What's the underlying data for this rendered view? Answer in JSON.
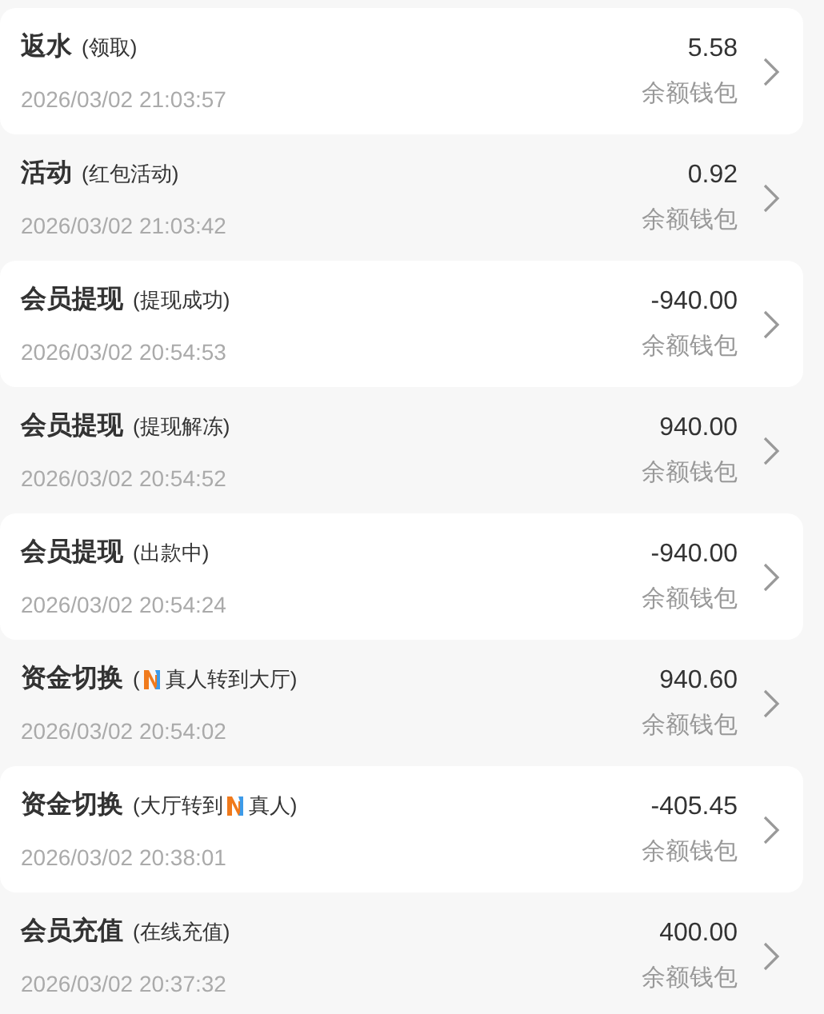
{
  "records": [
    {
      "title": "返水",
      "detail": [
        {
          "kind": "text",
          "text": "(领取)"
        }
      ],
      "time": "2026/03/02 21:03:57",
      "amount": "5.58",
      "wallet": "余额钱包"
    },
    {
      "title": "活动",
      "detail": [
        {
          "kind": "text",
          "text": "(红包活动)"
        }
      ],
      "time": "2026/03/02 21:03:42",
      "amount": "0.92",
      "wallet": "余额钱包"
    },
    {
      "title": "会员提现",
      "detail": [
        {
          "kind": "text",
          "text": "(提现成功)"
        }
      ],
      "time": "2026/03/02 20:54:53",
      "amount": "-940.00",
      "wallet": "余额钱包"
    },
    {
      "title": "会员提现",
      "detail": [
        {
          "kind": "text",
          "text": "(提现解冻)"
        }
      ],
      "time": "2026/03/02 20:54:52",
      "amount": "940.00",
      "wallet": "余额钱包"
    },
    {
      "title": "会员提现",
      "detail": [
        {
          "kind": "text",
          "text": "(出款中)"
        }
      ],
      "time": "2026/03/02 20:54:24",
      "amount": "-940.00",
      "wallet": "余额钱包"
    },
    {
      "title": "资金切换",
      "detail": [
        {
          "kind": "text",
          "text": "("
        },
        {
          "kind": "logo"
        },
        {
          "kind": "text",
          "text": "真人转到大厅)"
        }
      ],
      "time": "2026/03/02 20:54:02",
      "amount": "940.60",
      "wallet": "余额钱包"
    },
    {
      "title": "资金切换",
      "detail": [
        {
          "kind": "text",
          "text": "(大厅转到"
        },
        {
          "kind": "logo"
        },
        {
          "kind": "text",
          "text": "真人)"
        }
      ],
      "time": "2026/03/02 20:38:01",
      "amount": "-405.45",
      "wallet": "余额钱包"
    },
    {
      "title": "会员充值",
      "detail": [
        {
          "kind": "text",
          "text": "(在线充值)"
        }
      ],
      "time": "2026/03/02 20:37:32",
      "amount": "400.00",
      "wallet": "余额钱包"
    }
  ]
}
